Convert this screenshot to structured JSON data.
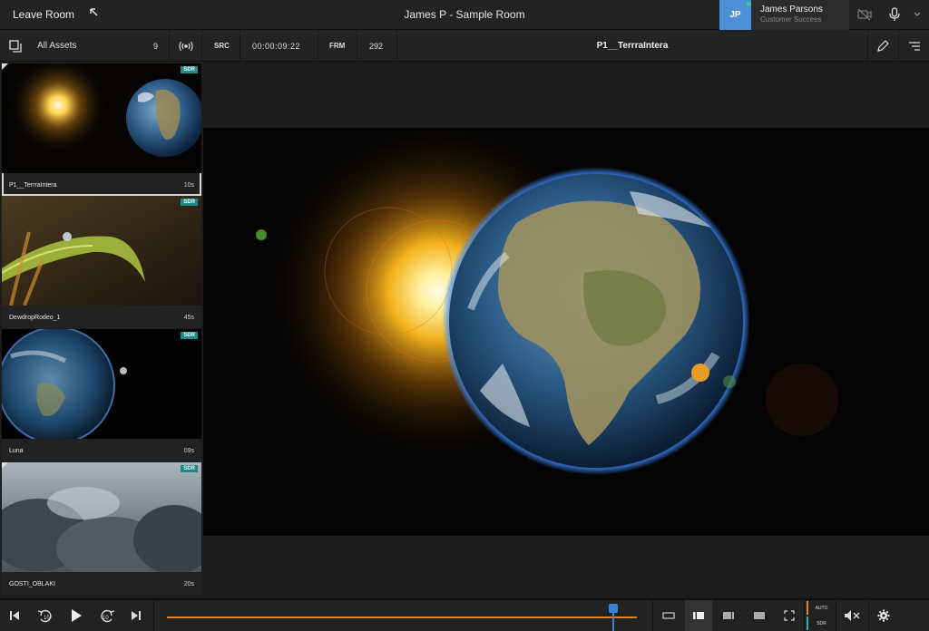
{
  "header": {
    "leave_label": "Leave Room",
    "room_title": "James P - Sample Room",
    "user_initials": "JP",
    "user_name": "James Parsons",
    "user_role": "Customer Success"
  },
  "toolbar": {
    "assets_label": "All Assets",
    "assets_count": "9",
    "src_label": "SRC",
    "timecode": "00:00:09:22",
    "frm_label": "FRM",
    "frame": "292",
    "asset_title": "P1__TerrraIntera"
  },
  "assets": [
    {
      "name": "P1__TerrraIntera",
      "duration": "10s",
      "badge": "SDR"
    },
    {
      "name": "DewdropRodeo_1",
      "duration": "45s",
      "badge": "SDR"
    },
    {
      "name": "Luna",
      "duration": "09s",
      "badge": "SDR"
    },
    {
      "name": "GOSTI_OBLAKI",
      "duration": "20s",
      "badge": "SDR"
    }
  ],
  "controls": {
    "tag_auto": "AUTO",
    "tag_sdr": "SDR",
    "playhead_fraction": 0.95
  },
  "colors": {
    "accent": "#3a83d6",
    "timeline": "#d9832a",
    "badge": "#1f8a8a"
  }
}
